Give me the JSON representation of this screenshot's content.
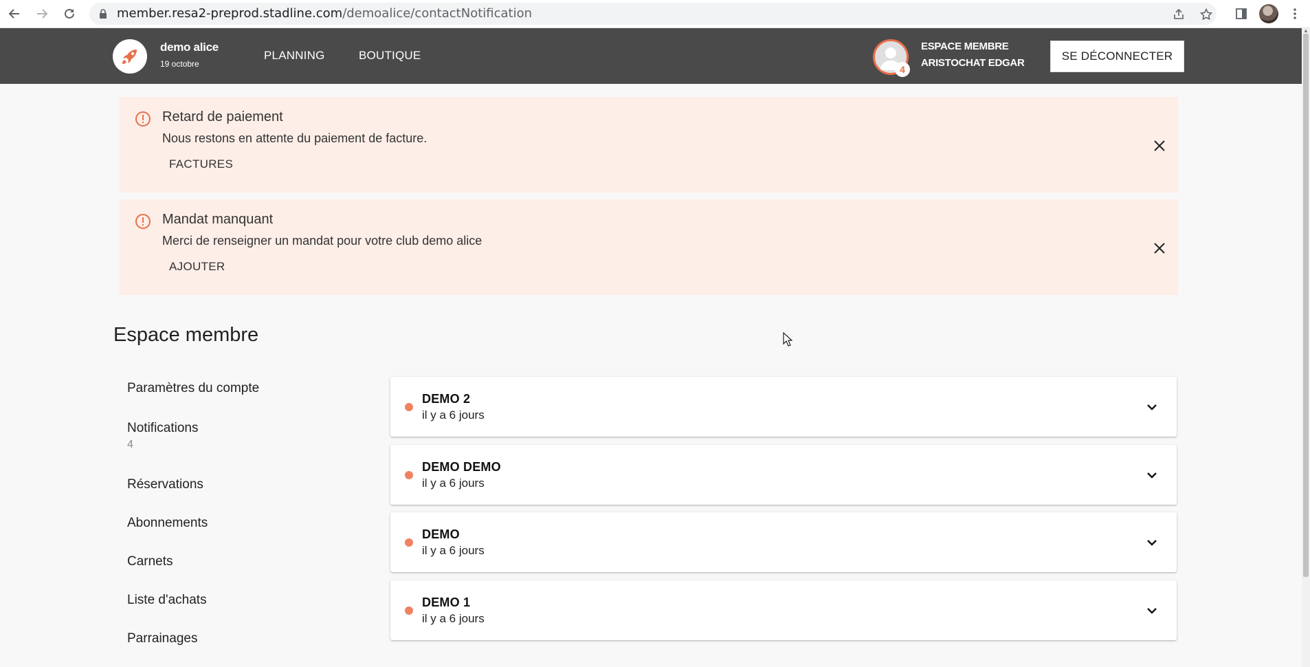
{
  "browser": {
    "url_host": "member.resa2-preprod.stadline.com",
    "url_path": "/demoalice/contactNotification"
  },
  "header": {
    "club_name": "demo alice",
    "club_date": "19 octobre",
    "nav": [
      "PLANNING",
      "BOUTIQUE"
    ],
    "member_label": "ESPACE MEMBRE",
    "member_name": "ARISTOCHAT EDGAR",
    "notification_badge": "4",
    "logout_label": "SE DÉCONNECTER"
  },
  "alerts": [
    {
      "title": "Retard de paiement",
      "message": "Nous restons en attente du paiement de facture.",
      "action": "FACTURES"
    },
    {
      "title": "Mandat manquant",
      "message": "Merci de renseigner un mandat pour votre club demo alice",
      "action": "AJOUTER"
    }
  ],
  "page_title": "Espace membre",
  "sidebar": {
    "items": [
      "Paramètres du compte",
      "Notifications",
      "Réservations",
      "Abonnements",
      "Carnets",
      "Liste d'achats",
      "Parrainages"
    ],
    "notifications_count": "4"
  },
  "notifications": [
    {
      "title": "DEMO 2",
      "time": "il y a 6 jours"
    },
    {
      "title": "DEMO DEMO",
      "time": "il y a 6 jours"
    },
    {
      "title": "DEMO",
      "time": "il y a 6 jours"
    },
    {
      "title": "DEMO 1",
      "time": "il y a 6 jours"
    }
  ],
  "colors": {
    "accent": "#e8704a",
    "header_bg": "#4a4a4a",
    "alert_bg": "#fdeee8",
    "unread_dot": "#f08262"
  }
}
